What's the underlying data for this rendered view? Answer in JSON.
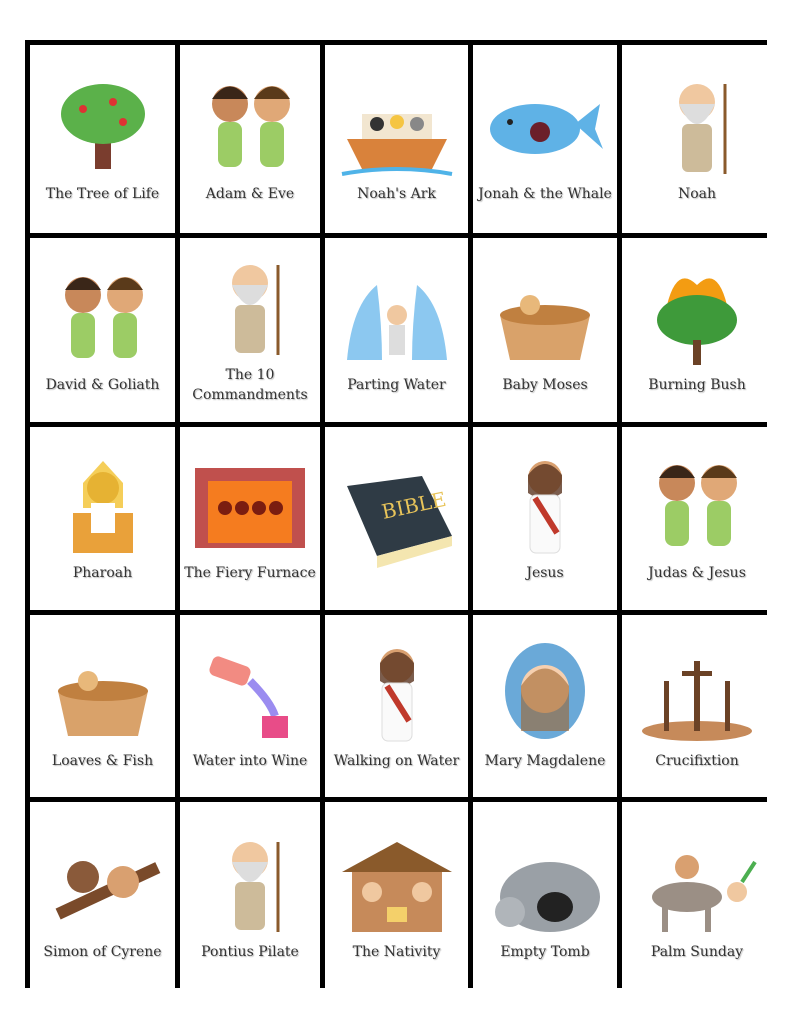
{
  "cards": [
    {
      "label": "The Tree of Life",
      "icon": "tree-icon"
    },
    {
      "label": "Adam & Eve",
      "icon": "people-icon"
    },
    {
      "label": "Noah's Ark",
      "icon": "ark-icon"
    },
    {
      "label": "Jonah & the Whale",
      "icon": "whale-icon"
    },
    {
      "label": "Noah",
      "icon": "old-man-icon"
    },
    {
      "label": "David & Goliath",
      "icon": "people-icon"
    },
    {
      "label": "The 10 Commandments",
      "icon": "old-man-icon"
    },
    {
      "label": "Parting Water",
      "icon": "waves-icon"
    },
    {
      "label": "Baby Moses",
      "icon": "basket-icon"
    },
    {
      "label": "Burning Bush",
      "icon": "burning-bush-icon"
    },
    {
      "label": "Pharoah",
      "icon": "pharaoh-icon"
    },
    {
      "label": "The Fiery Furnace",
      "icon": "furnace-icon"
    },
    {
      "label": "",
      "icon": "bible-icon",
      "logo_text": "BIBLE"
    },
    {
      "label": "Jesus",
      "icon": "jesus-icon"
    },
    {
      "label": "Judas & Jesus",
      "icon": "people-icon"
    },
    {
      "label": "Loaves & Fish",
      "icon": "basket-icon"
    },
    {
      "label": "Water into Wine",
      "icon": "jug-icon"
    },
    {
      "label": "Walking on Water",
      "icon": "jesus-icon"
    },
    {
      "label": "Mary Magdalene",
      "icon": "mary-icon"
    },
    {
      "label": "Crucifixtion",
      "icon": "crosses-icon"
    },
    {
      "label": "Simon of Cyrene",
      "icon": "cross-carry-icon"
    },
    {
      "label": "Pontius Pilate",
      "icon": "old-man-icon"
    },
    {
      "label": "The Nativity",
      "icon": "stable-icon"
    },
    {
      "label": "Empty Tomb",
      "icon": "tomb-icon"
    },
    {
      "label": "Palm Sunday",
      "icon": "donkey-icon"
    }
  ]
}
